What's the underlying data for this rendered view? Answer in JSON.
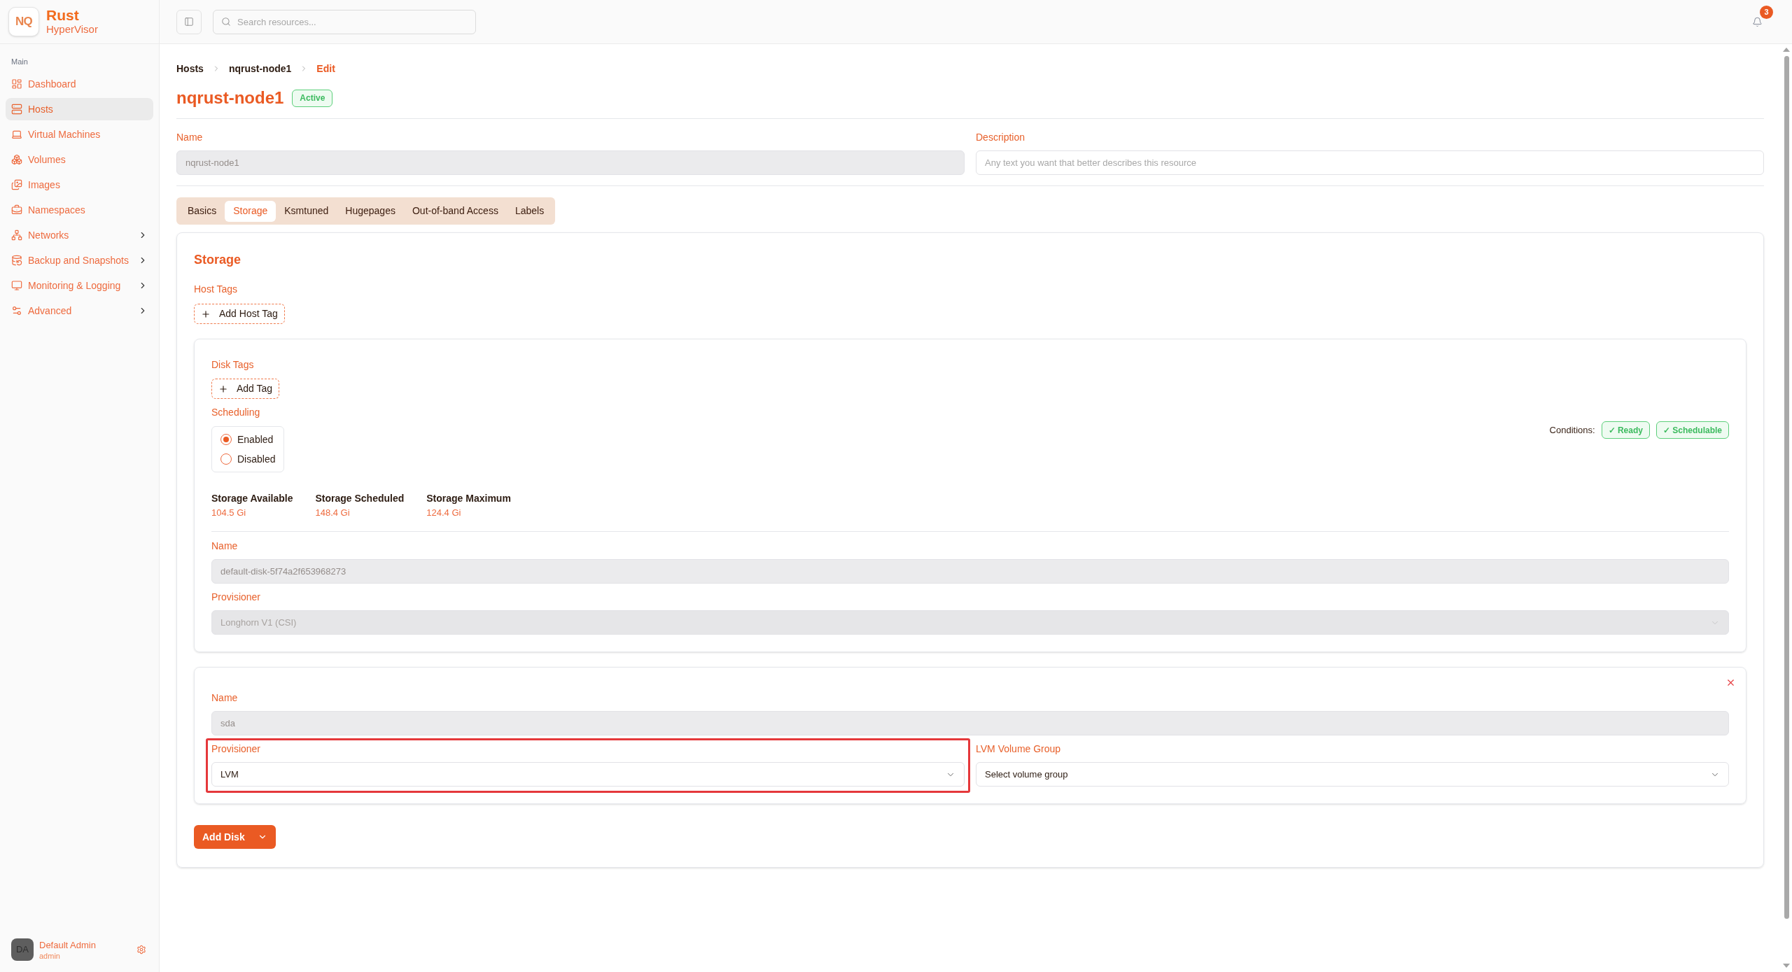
{
  "sidebar": {
    "brand": {
      "logo": "NQ",
      "title": "Rust",
      "subtitle": "HyperVisor"
    },
    "section": "Main",
    "items": [
      {
        "label": "Dashboard",
        "selected": false,
        "expandable": false
      },
      {
        "label": "Hosts",
        "selected": true,
        "expandable": false
      },
      {
        "label": "Virtual Machines",
        "selected": false,
        "expandable": false
      },
      {
        "label": "Volumes",
        "selected": false,
        "expandable": false
      },
      {
        "label": "Images",
        "selected": false,
        "expandable": false
      },
      {
        "label": "Namespaces",
        "selected": false,
        "expandable": false
      },
      {
        "label": "Networks",
        "selected": false,
        "expandable": true
      },
      {
        "label": "Backup and Snapshots",
        "selected": false,
        "expandable": true
      },
      {
        "label": "Monitoring & Logging",
        "selected": false,
        "expandable": true
      },
      {
        "label": "Advanced",
        "selected": false,
        "expandable": true
      }
    ],
    "user": {
      "initials": "DA",
      "name": "Default Admin",
      "role": "admin"
    }
  },
  "header": {
    "search": {
      "placeholder": "Search resources..."
    },
    "notifications": {
      "count": "3"
    }
  },
  "breadcrumb": [
    {
      "label": "Hosts",
      "current": false
    },
    {
      "label": "nqrust-node1",
      "current": false
    },
    {
      "label": "Edit",
      "current": true
    }
  ],
  "page": {
    "title": "nqrust-node1",
    "status": "Active"
  },
  "fields": [
    {
      "kind": "input",
      "label": "Name",
      "value": "nqrust-node1",
      "disabled": true
    },
    {
      "kind": "input",
      "label": "Description",
      "placeholder": "Any text you want that better describes this resource",
      "disabled": false
    }
  ],
  "tabs": [
    {
      "label": "Basics",
      "selected": false
    },
    {
      "label": "Storage",
      "selected": true
    },
    {
      "label": "Ksmtuned",
      "selected": false
    },
    {
      "label": "Hugepages",
      "selected": false
    },
    {
      "label": "Out-of-band Access",
      "selected": false
    },
    {
      "label": "Labels",
      "selected": false
    }
  ],
  "storage": {
    "title": "Storage",
    "host_tags": {
      "label": "Host Tags",
      "button": "Add Host Tag"
    },
    "disks": [
      {
        "removable": false,
        "tags": {
          "label": "Disk Tags",
          "button": "Add Tag"
        },
        "scheduling": {
          "label": "Scheduling",
          "options": [
            {
              "label": "Enabled",
              "selected": true
            },
            {
              "label": "Disabled",
              "selected": false
            }
          ]
        },
        "conditions": {
          "label": "Conditions:",
          "items": [
            "✓ Ready",
            "✓ Schedulable"
          ]
        },
        "stats": [
          {
            "label": "Storage Available",
            "value": "104.5 Gi"
          },
          {
            "label": "Storage Scheduled",
            "value": "148.4 Gi"
          },
          {
            "label": "Storage Maximum",
            "value": "124.4 Gi"
          }
        ],
        "rows": [
          [
            {
              "kind": "input",
              "label": "Name",
              "value": "default-disk-5f74a2f653968273",
              "disabled": true,
              "highlighted": false
            }
          ],
          [
            {
              "kind": "select",
              "label": "Provisioner",
              "value": "Longhorn V1 (CSI)",
              "disabled": true,
              "highlighted": false
            }
          ]
        ]
      },
      {
        "removable": true,
        "rows": [
          [
            {
              "kind": "input",
              "label": "Name",
              "value": "sda",
              "disabled": true,
              "highlighted": false
            }
          ],
          [
            {
              "kind": "select",
              "label": "Provisioner",
              "value": "LVM",
              "disabled": false,
              "highlighted": true
            },
            {
              "kind": "select",
              "label": "LVM Volume Group",
              "placeholder": "Select volume group",
              "disabled": false,
              "highlighted": false
            }
          ]
        ]
      }
    ],
    "add_disk": {
      "label": "Add Disk"
    }
  }
}
